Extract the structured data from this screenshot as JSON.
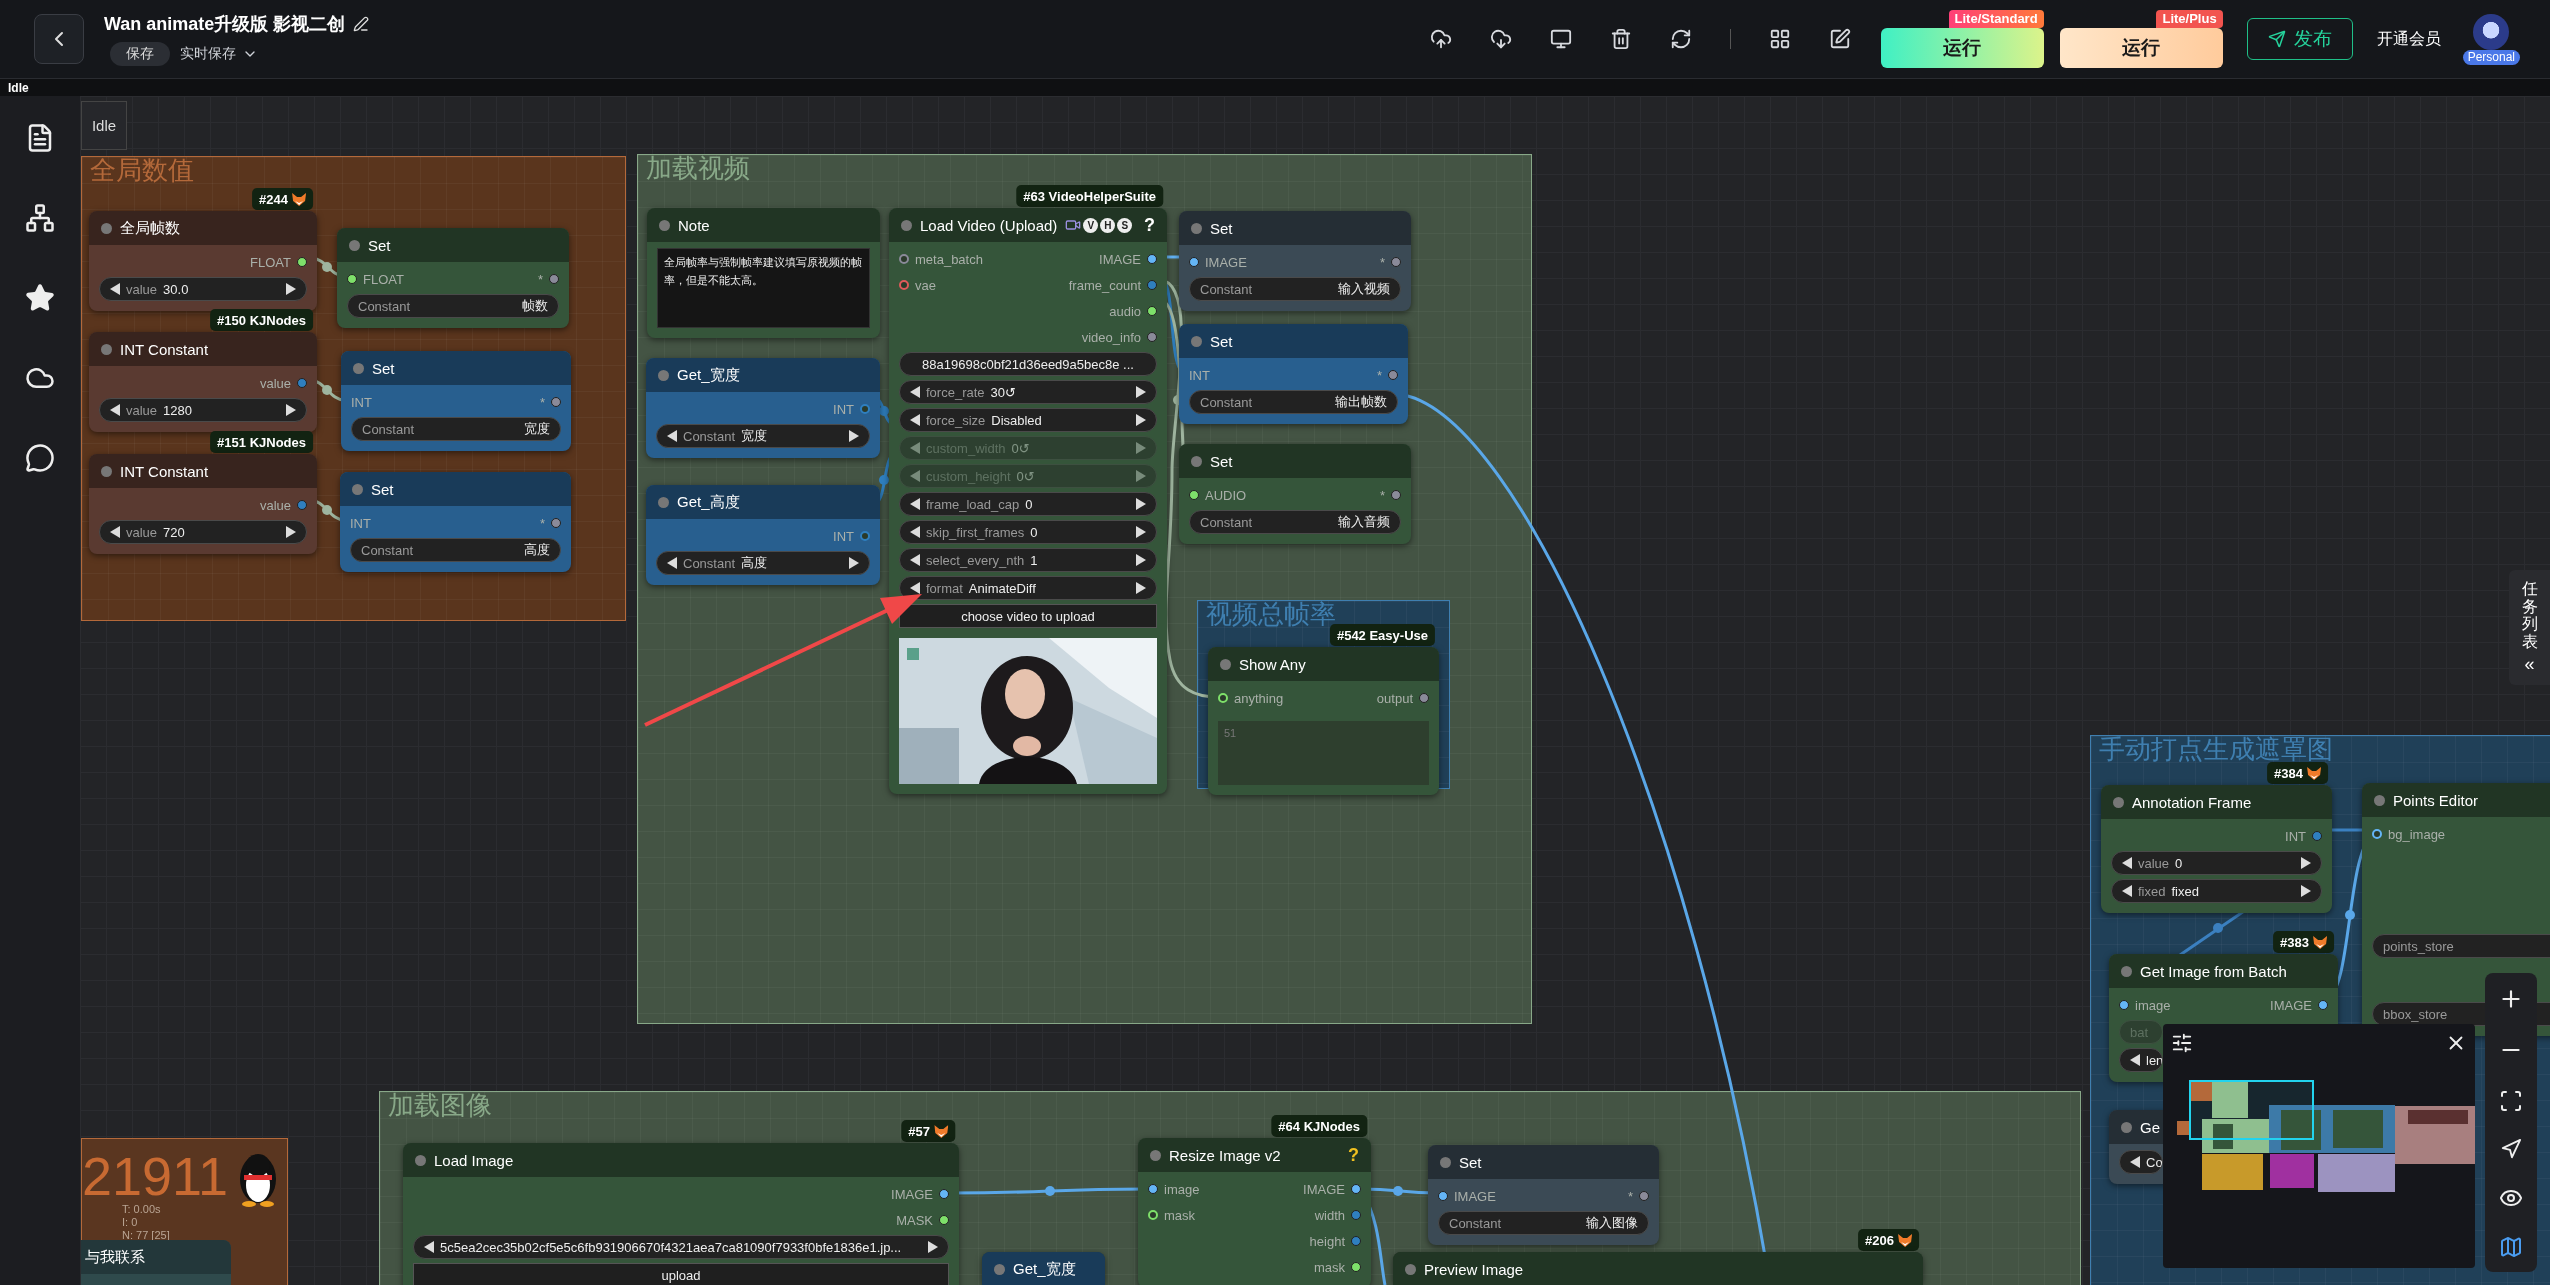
{
  "app": {
    "title": "Wan animate升级版 影视二创",
    "save": "保存",
    "autosave": "实时保存",
    "status": "Idle"
  },
  "toolbar": {
    "run_buttons": [
      {
        "label": "运行",
        "tier": "Lite/Standard",
        "kind": "standard"
      },
      {
        "label": "运行",
        "tier": "Lite/Plus",
        "kind": "plus"
      }
    ],
    "publish": "发布",
    "membership": "开通会员",
    "account_badge": "Personal"
  },
  "canvas": {
    "queue_label": "Idle"
  },
  "task_tab": {
    "label": "任务列表",
    "toggle": "«"
  },
  "groups": [
    {
      "title": "全局数值",
      "color": "#b4693a"
    },
    {
      "title": "加载视频",
      "color": "#88a888"
    },
    {
      "title": "视频总帧率",
      "color": "#3f7fb0"
    },
    {
      "title": "加载图像",
      "color": "#88a888"
    },
    {
      "title": "手动打点生成遮罩图",
      "color": "#3f7fb0"
    }
  ],
  "nodes": [
    {
      "title": "全局帧数",
      "color": "#5a3a31",
      "badge": "#244",
      "outputs": [
        {
          "name": "FLOAT",
          "color": "#7ee06a",
          "optional": false
        }
      ],
      "widgets": [
        {
          "kind": "stepper",
          "label": "value",
          "value": "30.0",
          "disabled": false
        }
      ]
    },
    {
      "title": "INT Constant",
      "color": "#5a3a31",
      "badge": "#150 KJNodes",
      "outputs": [
        {
          "name": "value",
          "color": "#2f7fbf",
          "optional": false
        }
      ],
      "widgets": [
        {
          "kind": "stepper",
          "label": "value",
          "value": "1280",
          "disabled": false
        }
      ]
    },
    {
      "title": "INT Constant",
      "color": "#5a3a31",
      "badge": "#151 KJNodes",
      "outputs": [
        {
          "name": "value",
          "color": "#2f7fbf",
          "optional": false
        }
      ],
      "widgets": [
        {
          "kind": "stepper",
          "label": "value",
          "value": "720",
          "disabled": false
        }
      ]
    },
    {
      "title": "Set",
      "color": "#35553a",
      "inputs": [
        {
          "name": "FLOAT",
          "color": "#7ee06a",
          "optional": false
        }
      ],
      "outputs": [
        {
          "name": "*",
          "color": "#8a8a99",
          "optional": false
        }
      ],
      "widgets": [
        {
          "kind": "constant",
          "label": "Constant",
          "value": "帧数",
          "disabled": false
        }
      ]
    },
    {
      "title": "Set",
      "color": "#285f8f",
      "inputs": [
        {
          "name": "INT"
        }
      ],
      "outputs": [
        {
          "name": "*",
          "color": "#8a8a99",
          "optional": false
        }
      ],
      "widgets": [
        {
          "kind": "constant",
          "label": "Constant",
          "value": "宽度",
          "disabled": false
        }
      ]
    },
    {
      "title": "Set",
      "color": "#285f8f",
      "inputs": [
        {
          "name": "INT"
        }
      ],
      "outputs": [
        {
          "name": "*",
          "color": "#8a8a99",
          "optional": false
        }
      ],
      "widgets": [
        {
          "kind": "constant",
          "label": "Constant",
          "value": "高度",
          "disabled": false
        }
      ]
    },
    {
      "title": "Note",
      "color": "#35553a",
      "widgets": [
        {
          "kind": "note",
          "value": "全局帧率与强制帧率建议填写原视频的帧率，但是不能太高。",
          "disabled": false
        }
      ]
    },
    {
      "title": "Get_宽度",
      "color": "#285f8f",
      "outputs": [
        {
          "name": "INT",
          "color": "#2f7fbf",
          "optional": true
        }
      ],
      "widgets": [
        {
          "kind": "stepper",
          "label": "Constant",
          "value": "宽度",
          "disabled": false
        }
      ]
    },
    {
      "title": "Get_高度",
      "color": "#285f8f",
      "outputs": [
        {
          "name": "INT",
          "color": "#2f7fbf",
          "optional": true
        }
      ],
      "widgets": [
        {
          "kind": "stepper",
          "label": "Constant",
          "value": "高度",
          "disabled": false
        }
      ]
    },
    {
      "title": "Load Video (Upload)",
      "color": "#35553a",
      "badge": "#63 VideoHelperSuite",
      "tags": [
        "V",
        "H",
        "S"
      ],
      "help": {
        "text": "?",
        "color": "#ffffff"
      },
      "inputs": [
        {
          "name": "meta_batch",
          "color": "#8a8a99",
          "optional": true
        },
        {
          "name": "vae",
          "color": "#e05a5a",
          "optional": true
        }
      ],
      "outputs": [
        {
          "name": "IMAGE",
          "color": "#64b5f6",
          "optional": false
        },
        {
          "name": "frame_count",
          "color": "#2f7fbf",
          "optional": false
        },
        {
          "name": "audio",
          "color": "#7ee06a",
          "optional": false
        },
        {
          "name": "video_info",
          "color": "#8a8a99",
          "optional": false
        }
      ],
      "widgets": [
        {
          "kind": "field",
          "label": "88a19698c0bf21d36eed9a5bec8e ...",
          "disabled": false
        },
        {
          "kind": "stepper",
          "label": "force_rate",
          "value": "30↺",
          "disabled": false
        },
        {
          "kind": "stepper",
          "label": "force_size",
          "value": "Disabled",
          "disabled": false
        },
        {
          "kind": "stepper",
          "label": "custom_width",
          "value": "0↺",
          "disabled": true
        },
        {
          "kind": "stepper",
          "label": "custom_height",
          "value": "0↺",
          "disabled": true
        },
        {
          "kind": "stepper",
          "label": "frame_load_cap",
          "value": "0",
          "disabled": false
        },
        {
          "kind": "stepper",
          "label": "skip_first_frames",
          "value": "0",
          "disabled": false
        },
        {
          "kind": "stepper",
          "label": "select_every_nth",
          "value": "1",
          "disabled": false
        },
        {
          "kind": "stepper",
          "label": "format",
          "value": "AnimateDiff",
          "disabled": false
        },
        {
          "kind": "button",
          "label": "choose video to upload",
          "disabled": false
        },
        {
          "kind": "picture"
        }
      ]
    },
    {
      "title": "Set",
      "color": "#3b4a55",
      "inputs": [
        {
          "name": "IMAGE",
          "color": "#64b5f6",
          "optional": false
        }
      ],
      "outputs": [
        {
          "name": "*",
          "color": "#8a8a99",
          "optional": false
        }
      ],
      "widgets": [
        {
          "kind": "constant",
          "label": "Constant",
          "value": "输入视频",
          "disabled": false
        }
      ]
    },
    {
      "title": "Set",
      "color": "#285f8f",
      "inputs": [
        {
          "name": "INT"
        }
      ],
      "outputs": [
        {
          "name": "*",
          "color": "#8a8a99",
          "optional": false
        }
      ],
      "widgets": [
        {
          "kind": "constant",
          "label": "Constant",
          "value": "输出帧数",
          "disabled": false
        }
      ]
    },
    {
      "title": "Set",
      "color": "#35553a",
      "inputs": [
        {
          "name": "AUDIO",
          "color": "#7ee06a",
          "optional": false
        }
      ],
      "outputs": [
        {
          "name": "*",
          "color": "#8a8a99",
          "optional": false
        }
      ],
      "widgets": [
        {
          "kind": "constant",
          "label": "Constant",
          "value": "输入音频",
          "disabled": false
        }
      ]
    },
    {
      "title": "Show Any",
      "color": "#35553a",
      "badge": "#542 Easy-Use",
      "inputs": [
        {
          "name": "anything",
          "color": "#7ee06a",
          "optional": true
        }
      ],
      "outputs": [
        {
          "name": "output",
          "color": "#8a8a99",
          "optional": false
        }
      ],
      "widgets": [
        {
          "kind": "textarea",
          "value": "51",
          "disabled": false
        }
      ]
    },
    {
      "title": "Load Image",
      "color": "#35553a",
      "badge": "#57",
      "outputs": [
        {
          "name": "IMAGE",
          "color": "#64b5f6",
          "optional": false
        },
        {
          "name": "MASK",
          "color": "#7ee06a",
          "optional": false
        }
      ],
      "widgets": [
        {
          "kind": "stepper",
          "label": "5c5ea2cec35b02cf5e5c6fb931906670f4321aea7ca81090f7933f0bfe1836e1.jp...",
          "disabled": false
        },
        {
          "kind": "button",
          "label": "upload",
          "disabled": false
        }
      ]
    },
    {
      "title": "Resize Image v2",
      "color": "#35553a",
      "badge": "#64 KJNodes",
      "help": {
        "text": "?",
        "color": "#f0c020"
      },
      "inputs": [
        {
          "name": "image",
          "color": "#64b5f6",
          "optional": false
        },
        {
          "name": "mask",
          "color": "#7ee06a",
          "optional": true
        }
      ],
      "outputs": [
        {
          "name": "IMAGE",
          "color": "#64b5f6",
          "optional": false
        },
        {
          "name": "width",
          "color": "#2f7fbf",
          "optional": false
        },
        {
          "name": "height",
          "color": "#2f7fbf",
          "optional": false
        },
        {
          "name": "mask",
          "color": "#7ee06a",
          "optional": false
        }
      ]
    },
    {
      "title": "Set",
      "color": "#3b4a55",
      "inputs": [
        {
          "name": "IMAGE",
          "color": "#64b5f6",
          "optional": false
        }
      ],
      "outputs": [
        {
          "name": "*",
          "color": "#8a8a99",
          "optional": false
        }
      ],
      "widgets": [
        {
          "kind": "constant",
          "label": "Constant",
          "value": "输入图像",
          "disabled": false
        }
      ]
    },
    {
      "title": "Get_宽度",
      "color": "#193b59"
    },
    {
      "title": "Preview Image",
      "color": "#213524",
      "badge": "#206"
    },
    {
      "title": "Annotation Frame",
      "color": "#35553a",
      "badge": "#384",
      "outputs": [
        {
          "name": "INT",
          "color": "#2f7fbf",
          "optional": false
        }
      ],
      "widgets": [
        {
          "kind": "stepper",
          "label": "value",
          "value": "0",
          "disabled": false
        },
        {
          "kind": "stepper",
          "label": "fixed",
          "value": "fixed",
          "disabled": false
        }
      ]
    },
    {
      "title": "Get Image from Batch",
      "color": "#35553a",
      "badge": "#383",
      "inputs": [
        {
          "name": "image",
          "color": "#64b5f6",
          "optional": false
        }
      ],
      "outputs": [
        {
          "name": "IMAGE",
          "color": "#64b5f6",
          "optional": false
        }
      ],
      "widgets": [
        {
          "kind": "input",
          "label": "bat",
          "disabled": true
        },
        {
          "kind": "stepper",
          "label": "len",
          "disabled": false
        }
      ]
    },
    {
      "title": "Points Editor",
      "color": "#35553a",
      "inputs": [
        {
          "name": "bg_image",
          "color": "#64b5f6",
          "optional": true
        }
      ],
      "widgets": [
        {
          "kind": "input",
          "label": "points_store",
          "disabled": false
        },
        {
          "kind": "input",
          "label": "bbox_store",
          "disabled": false
        }
      ]
    },
    {
      "title": "Ge",
      "color": "#3b4a55",
      "widgets": [
        {
          "kind": "stepper",
          "label": "Co",
          "disabled": false
        }
      ]
    }
  ],
  "stats_panel": {
    "count": "21911",
    "lines": [
      "T: 0.00s",
      "I: 0",
      "N: 77 [25]"
    ],
    "node_title": "与我联系"
  }
}
